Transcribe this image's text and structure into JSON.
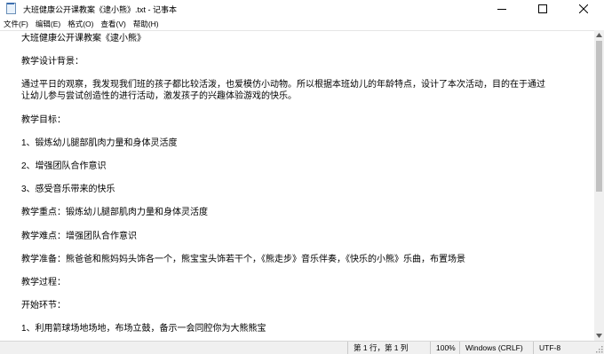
{
  "window": {
    "title": "大班健康公开课教案《逮小熊》.txt - 记事本"
  },
  "menu": [
    "文件(F)",
    "编辑(E)",
    "格式(O)",
    "查看(V)",
    "帮助(H)"
  ],
  "document": {
    "lines": [
      "大班健康公开课教案《逮小熊》",
      "",
      "教学设计背景：",
      "",
      "通过平日的观察，我发现我们班的孩子都比较活泼，也爱模仿小动物。所以根据本班幼儿的年龄特点，设计了本次活动，目的在于通过",
      "让幼儿参与尝试创造性的进行活动，激发孩子的兴趣体验游戏的快乐。",
      "",
      "教学目标：",
      "",
      "1、锻炼幼儿腿部肌肉力量和身体灵活度",
      "",
      "2、增强团队合作意识",
      "",
      "3、感受音乐带来的快乐",
      "",
      "教学重点：锻炼幼儿腿部肌肉力量和身体灵活度",
      "",
      "教学难点：增强团队合作意识",
      "",
      "教学准备：熊爸爸和熊妈妈头饰各一个，熊宝宝头饰若干个，《熊走步》音乐伴奏，《快乐的小熊》乐曲，布置场景",
      "",
      "教学过程：",
      "",
      "开始环节：",
      "",
      "1、利用箭球场地场地，布场立鼓，备示一会同腔你为大熊熊宝"
    ]
  },
  "statusbar": {
    "position": "第 1 行，第 1 列",
    "zoom": "100%",
    "line_ending": "Windows (CRLF)",
    "encoding": "UTF-8"
  },
  "scrollbar": {
    "thumb_fraction": 0.52,
    "scroll_fraction": 0.0
  }
}
